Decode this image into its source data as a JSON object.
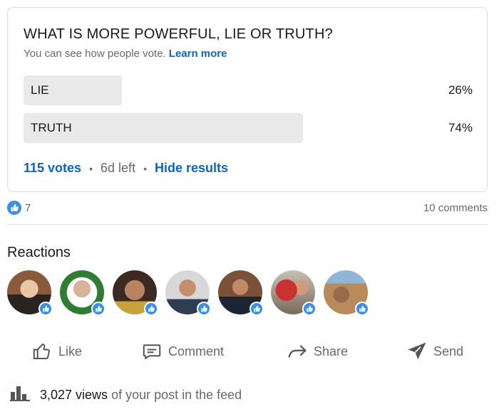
{
  "poll": {
    "question": "WHAT IS MORE POWERFUL, LIE OR TRUTH?",
    "subtitle": "You can see how people vote.",
    "learn_more": "Learn more",
    "options": [
      {
        "label": "LIE",
        "percent_text": "26%",
        "percent": 26
      },
      {
        "label": "TRUTH",
        "percent_text": "74%",
        "percent": 74
      }
    ],
    "votes": "115 votes",
    "time_left": "6d left",
    "hide_results": "Hide results"
  },
  "social": {
    "like_icon": "thumbs-up-icon",
    "like_count": "7",
    "comments": "10 comments"
  },
  "reactions": {
    "title": "Reactions",
    "count": 7,
    "reaction_icon": "thumbs-up-icon"
  },
  "actions": {
    "like": "Like",
    "comment": "Comment",
    "share": "Share",
    "send": "Send"
  },
  "views": {
    "icon": "bar-chart-icon",
    "count": "3,027 views",
    "rest": "of your post in the feed"
  },
  "colors": {
    "accent": "#0a66c2",
    "like_blue": "#378fe9",
    "poll_bar": "#e9e9e9"
  }
}
